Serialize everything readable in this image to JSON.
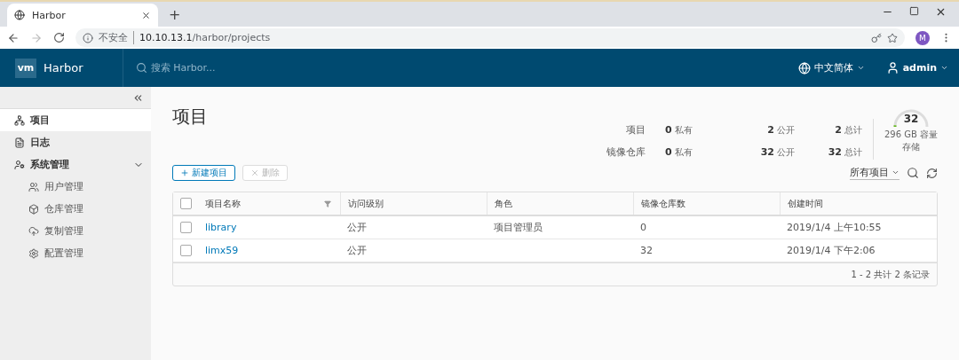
{
  "browser": {
    "tab_title": "Harbor",
    "new_tab": "+",
    "security": "不安全",
    "url_host": "10.10.13.1",
    "url_path": "/harbor/projects",
    "profile": "M"
  },
  "header": {
    "logo": "vm",
    "brand": "Harbor",
    "search_placeholder": "搜索 Harbor...",
    "language": "中文简体",
    "user": "admin"
  },
  "sidebar": {
    "items": [
      {
        "label": "项目",
        "selected": true
      },
      {
        "label": "日志",
        "selected": false
      },
      {
        "label": "系统管理",
        "selected": false,
        "expanded": true,
        "children": [
          {
            "label": "用户管理",
            "selected": false
          },
          {
            "label": "仓库管理",
            "selected": false
          },
          {
            "label": "复制管理",
            "selected": false
          },
          {
            "label": "配置管理",
            "selected": false
          }
        ]
      }
    ]
  },
  "page_title": "项目",
  "summary": [
    {
      "label": "项目",
      "cells": [
        {
          "value": "0",
          "unit": "私有"
        },
        {
          "value": "2",
          "unit": "公开"
        },
        {
          "value": "2",
          "unit": "总计"
        }
      ]
    },
    {
      "label": "镜像仓库",
      "cells": [
        {
          "value": "0",
          "unit": "私有"
        },
        {
          "value": "32",
          "unit": "公开"
        },
        {
          "value": "32",
          "unit": "总计"
        }
      ]
    }
  ],
  "storage": {
    "value": "32",
    "capacity": "296 GB 容量",
    "label": "存储",
    "level": 0.03
  },
  "toolbar": {
    "buttons": [
      {
        "label": "新建项目",
        "disabled": false
      },
      {
        "label": "删除",
        "disabled": true
      }
    ],
    "filter": "所有项目"
  },
  "table": {
    "all_checked": false,
    "columns": [
      "项目名称",
      "访问级别",
      "角色",
      "镜像仓库数",
      "创建时间"
    ],
    "rows": [
      {
        "checked": false,
        "cells": [
          "library",
          "公开",
          "项目管理员",
          "0",
          "2019/1/4 上午10:55"
        ]
      },
      {
        "checked": false,
        "cells": [
          "limx59",
          "公开",
          "",
          "32",
          "2019/1/4 下午2:06"
        ]
      }
    ],
    "footer": "1 - 2 共计 2 条记录"
  }
}
